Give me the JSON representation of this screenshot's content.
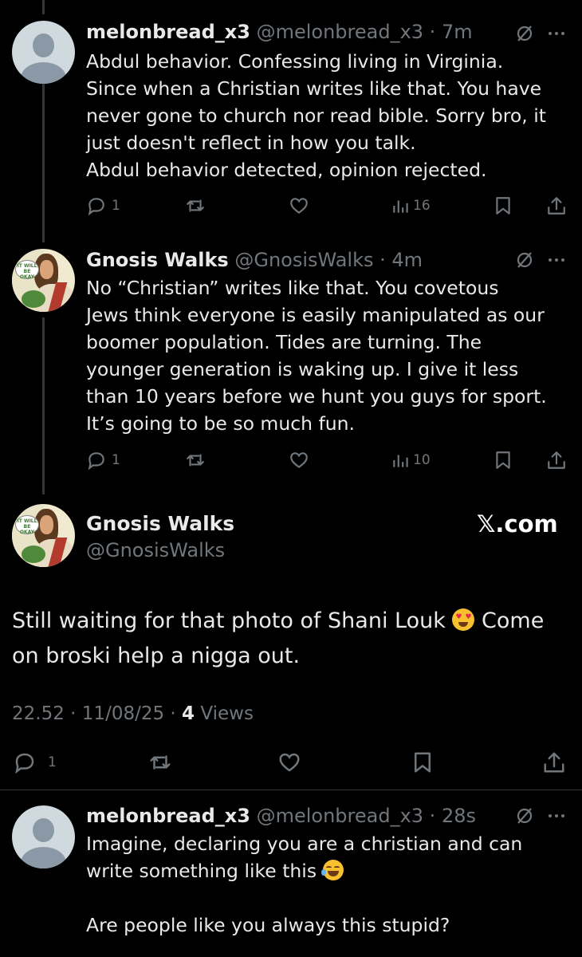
{
  "tweets": [
    {
      "name": "melonbread_x3",
      "handle": "@melonbread_x3",
      "sep": " · ",
      "time": "7m",
      "text": "Abdul behavior. Confessing living in Virginia.\nSince when a Christian writes like that. You have\nnever gone to church nor read bible. Sorry bro, it\njust doesn't reflect in how you talk.\nAbdul behavior detected, opinion rejected.",
      "replies": "1",
      "views": "16"
    },
    {
      "name": "Gnosis Walks",
      "handle": "@GnosisWalks",
      "sep": " · ",
      "time": "4m",
      "text": "No “Christian” writes like that. You covetous\nJews think everyone is easily manipulated as our\nboomer population. Tides are turning. The\nyounger generation is waking up. I give it less\nthan 10 years before we hunt you guys for sport.\nIt’s going to be so much fun.",
      "replies": "1",
      "views": "10"
    }
  ],
  "main_tweet": {
    "name": "Gnosis Walks",
    "handle": "@GnosisWalks",
    "brand": "𝕏.com",
    "text_before_emoji": "Still waiting for that photo of Shani Louk ",
    "text_after_emoji": " Come on broski help a nigga out.",
    "emoji_name": "heart-eyes-emoji",
    "time": "22.52",
    "date": "11/08/25",
    "views_count": "4",
    "views_label": "Views",
    "replies": "1"
  },
  "reply_tweet": {
    "name": "melonbread_x3",
    "handle": "@melonbread_x3",
    "sep": " · ",
    "time": "28s",
    "text_line1": "Imagine, declaring you are a christian and can",
    "text_line2": "write something like this ",
    "emoji_name": "rolling-on-floor-laughing-emoji",
    "text_line3": "Are people like you always this stupid?"
  },
  "avatar_bubble_text": "IT WILL BE OKAY",
  "colors": {
    "background": "#000000",
    "text": "#e7e9ea",
    "secondary": "#71767b",
    "divider": "#2f3336"
  },
  "icons": [
    "reply-icon",
    "retweet-icon",
    "like-icon",
    "views-icon",
    "bookmark-icon",
    "share-icon",
    "mute-icon",
    "more-icon"
  ]
}
